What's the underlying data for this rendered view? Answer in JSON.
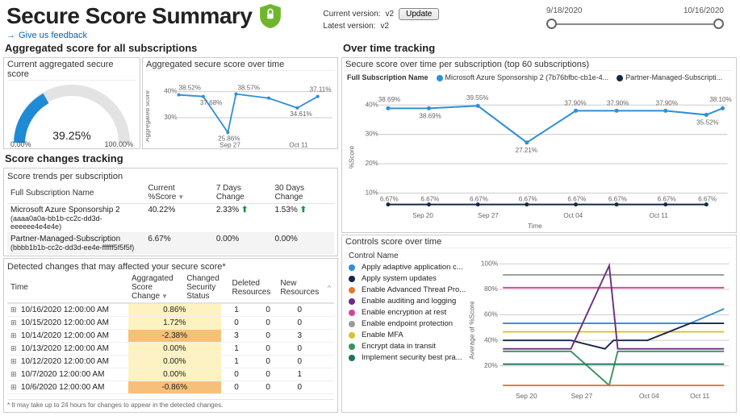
{
  "header": {
    "title": "Secure Score Summary",
    "feedback_label": "Give us feedback",
    "current_version_label": "Current version:",
    "current_version_value": "v2",
    "latest_version_label": "Latest version:",
    "latest_version_value": "v2",
    "update_label": "Update",
    "date_start": "9/18/2020",
    "date_end": "10/16/2020"
  },
  "left": {
    "agg_title": "Aggregated score for all subscriptions",
    "gauge_title": "Current aggregated secure score",
    "gauge_min": "0.00%",
    "gauge_max": "100.00%",
    "gauge_value": "39.25%",
    "overtime_title": "Aggregated secure score over time",
    "changes_title": "Score changes tracking",
    "trends_subtitle": "Score trends per subscription",
    "trends_headers": {
      "name": "Full Subscription Name",
      "current": "Current %Score",
      "d7": "7 Days Change",
      "d30": "30 Days Change"
    },
    "trends_rows": [
      {
        "name": "Microsoft Azure Sponsorship 2",
        "guid": "(aaaa0a0a-bb1b-cc2c-dd3d-eeeeee4e4e4e)",
        "current": "40.22%",
        "d7": "2.33%",
        "d7_up": true,
        "d30": "1.53%",
        "d30_up": true
      },
      {
        "name": "Partner-Managed-Subscription",
        "guid": "(bbbb1b1b-cc2c-dd3d-ee4e-ffffff5f5f5f)",
        "current": "6.67%",
        "d7": "0.00%",
        "d7_up": false,
        "d30": "0.00%",
        "d30_up": false
      }
    ],
    "detected_title": "Detected changes that may affected your secure score*",
    "detected_headers": {
      "time": "Time",
      "agg": "Aggragated Score Change",
      "sec": "Changed Security Status",
      "del": "Deleted Resources",
      "new": "New Resources"
    },
    "detected_rows": [
      {
        "time": "10/16/2020 12:00:00 AM",
        "agg": "0.86%",
        "agg_cls": "pos",
        "sec": "1",
        "del": "0",
        "new": "0"
      },
      {
        "time": "10/15/2020 12:00:00 AM",
        "agg": "1.72%",
        "agg_cls": "pos",
        "sec": "0",
        "del": "0",
        "new": "0"
      },
      {
        "time": "10/14/2020 12:00:00 AM",
        "agg": "-2.38%",
        "agg_cls": "neg",
        "sec": "3",
        "del": "0",
        "new": "3"
      },
      {
        "time": "10/13/2020 12:00:00 AM",
        "agg": "0.00%",
        "agg_cls": "pos",
        "sec": "1",
        "del": "0",
        "new": "0"
      },
      {
        "time": "10/12/2020 12:00:00 AM",
        "agg": "0.00%",
        "agg_cls": "pos",
        "sec": "1",
        "del": "0",
        "new": "0"
      },
      {
        "time": "10/7/2020 12:00:00 AM",
        "agg": "0.00%",
        "agg_cls": "pos",
        "sec": "0",
        "del": "0",
        "new": "1"
      },
      {
        "time": "10/6/2020 12:00:00 AM",
        "agg": "-0.86%",
        "agg_cls": "neg",
        "sec": "0",
        "del": "0",
        "new": "0"
      }
    ],
    "footnote": "* It may take up to 24 hours for changes to appear in the detected changes."
  },
  "right": {
    "tracking_title": "Over time tracking",
    "per_sub_title": "Secure score over time per subscription (top 60 subscriptions)",
    "legend_label": "Full Subscription Name",
    "series": [
      {
        "name": "Microsoft Azure Sponsorship 2 (7b76bfbc-cb1e-4...",
        "color": "#2f8fd4"
      },
      {
        "name": "Partner-Managed-Subscripti...",
        "color": "#16284a"
      }
    ],
    "controls_title": "Controls score over time",
    "controls_legend_title": "Control Name",
    "controls": [
      {
        "name": "Apply adaptive application c...",
        "color": "#2f8fd4"
      },
      {
        "name": "Apply system updates",
        "color": "#16284a"
      },
      {
        "name": "Enable Advanced Threat Pro...",
        "color": "#e8762d"
      },
      {
        "name": "Enable auditing and logging",
        "color": "#6b2d82"
      },
      {
        "name": "Enable encryption at rest",
        "color": "#d6429d"
      },
      {
        "name": "Enable endpoint protection",
        "color": "#9a9a9a"
      },
      {
        "name": "Enable MFA",
        "color": "#d4c22f"
      },
      {
        "name": "Encrypt data in transit",
        "color": "#3a915f"
      },
      {
        "name": "Implement security best pra...",
        "color": "#167566"
      }
    ]
  },
  "chart_data": [
    {
      "id": "aggregated_over_time",
      "type": "line",
      "title": "Aggregated secure score over time",
      "ylabel": "Aggregated score",
      "ylim": [
        25,
        40
      ],
      "x": [
        "Sep 20",
        "Sep 23",
        "Sep 27",
        "Sep 30",
        "Oct 04",
        "Oct 08",
        "Oct 11",
        "Oct 15"
      ],
      "values": [
        38.52,
        37.68,
        25.86,
        38.57,
        38.0,
        37.5,
        34.61,
        37.11
      ],
      "annotations": [
        "38.52%",
        "37.68%",
        "25.86%",
        "38.57%",
        "34.61%",
        "37.11%"
      ]
    },
    {
      "id": "per_subscription",
      "type": "line",
      "title": "Secure score over time per subscription (top 60 subscriptions)",
      "xlabel": "Time",
      "ylabel": "%Score",
      "ylim": [
        0,
        45
      ],
      "x": [
        "Sep 20",
        "Sep 23",
        "Sep 27",
        "Sep 30",
        "Oct 04",
        "Oct 08",
        "Oct 11",
        "Oct 15"
      ],
      "series": [
        {
          "name": "Microsoft Azure Sponsorship 2 (7b76bfbc-cb1e-4...",
          "color": "#2f8fd4",
          "values": [
            38.69,
            38.69,
            39.55,
            27.21,
            37.9,
            37.9,
            37.9,
            35.52
          ],
          "annotations": [
            "38.69%",
            "38.69%",
            "39.55%",
            "27.21%",
            "37.90%",
            "37.90%",
            "37.90%",
            "35.52%",
            "38.10%"
          ]
        },
        {
          "name": "Partner-Managed-Subscripti...",
          "color": "#16284a",
          "values": [
            6.67,
            6.67,
            6.67,
            6.67,
            6.67,
            6.67,
            6.67,
            6.67
          ],
          "annotations": [
            "6.67%",
            "6.67%",
            "6.67%",
            "6.67%",
            "6.67%",
            "6.67%",
            "6.67%",
            "6.67%"
          ]
        }
      ]
    },
    {
      "id": "controls_over_time",
      "type": "line",
      "title": "Controls score over time",
      "xlabel": "Time",
      "ylabel": "Average of %Score",
      "ylim": [
        0,
        100
      ],
      "x": [
        "Sep 20",
        "Sep 27",
        "Oct 01",
        "Oct 04",
        "Oct 11",
        "Oct 16"
      ],
      "series": [
        {
          "name": "Apply adaptive application c...",
          "color": "#2f8fd4",
          "values": [
            50,
            50,
            50,
            50,
            50,
            62
          ]
        },
        {
          "name": "Apply system updates",
          "color": "#16284a",
          "values": [
            40,
            40,
            33,
            40,
            50,
            50
          ]
        },
        {
          "name": "Enable Advanced Threat Pro...",
          "color": "#e8762d",
          "values": [
            0,
            0,
            0,
            0,
            0,
            0
          ]
        },
        {
          "name": "Enable auditing and logging",
          "color": "#6b2d82",
          "values": [
            33,
            33,
            100,
            33,
            33,
            33
          ]
        },
        {
          "name": "Enable encryption at rest",
          "color": "#d6429d",
          "values": [
            80,
            80,
            80,
            80,
            80,
            80
          ]
        },
        {
          "name": "Enable endpoint protection",
          "color": "#9a9a9a",
          "values": [
            90,
            90,
            90,
            90,
            90,
            90
          ]
        },
        {
          "name": "Enable MFA",
          "color": "#d4c22f",
          "values": [
            45,
            45,
            45,
            45,
            45,
            45
          ]
        },
        {
          "name": "Encrypt data in transit",
          "color": "#3a915f",
          "values": [
            30,
            30,
            0,
            30,
            30,
            30
          ]
        },
        {
          "name": "Implement security best pra...",
          "color": "#167566",
          "values": [
            20,
            20,
            20,
            20,
            20,
            20
          ]
        }
      ]
    }
  ]
}
